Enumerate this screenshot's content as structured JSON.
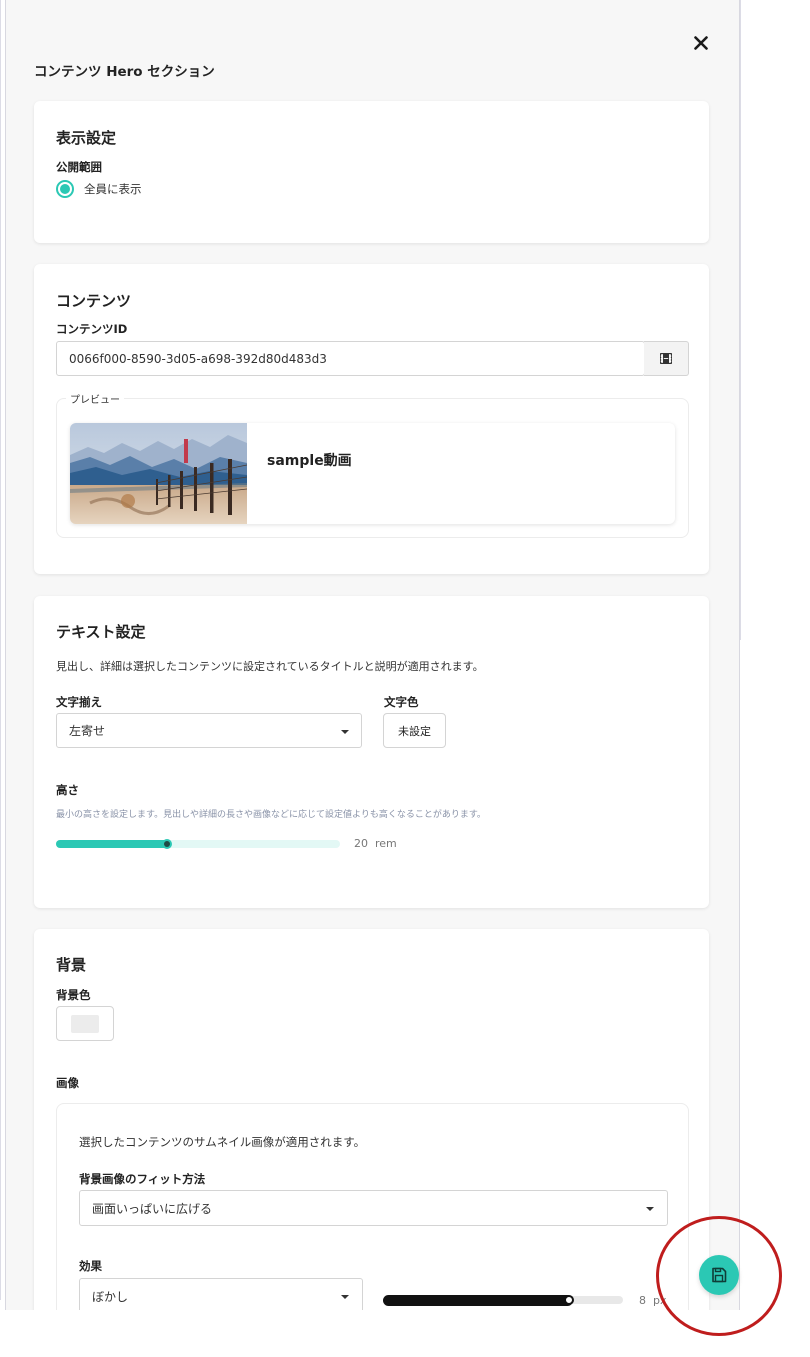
{
  "panel": {
    "title": "コンテンツ Hero セクション"
  },
  "display_settings": {
    "title": "表示設定",
    "visibility_label": "公開範囲",
    "visibility_option": "全員に表示"
  },
  "content": {
    "title": "コンテンツ",
    "id_label": "コンテンツID",
    "id_value": "0066f000-8590-3d05-a698-392d80d483d3",
    "preview_legend": "プレビュー",
    "preview_title": "sample動画"
  },
  "text_settings": {
    "title": "テキスト設定",
    "description": "見出し、詳細は選択したコンテンツに設定されているタイトルと説明が適用されます。",
    "align_label": "文字揃え",
    "align_value": "左寄せ",
    "color_label": "文字色",
    "color_value": "未設定",
    "height_label": "高さ",
    "height_help": "最小の高さを設定します。見出しや詳細の長さや画像などに応じて設定値よりも高くなることがあります。",
    "height_value": "20",
    "height_unit": "rem",
    "height_fraction": 0.4
  },
  "background": {
    "title": "背景",
    "color_label": "背景色",
    "image_label": "画像",
    "image_note": "選択したコンテンツのサムネイル画像が適用されます。",
    "fit_label": "背景画像のフィット方法",
    "fit_value": "画面いっぱいに広げる",
    "effect_label": "効果",
    "effect_value": "ぼかし",
    "effect_amount": "8",
    "effect_unit": "px",
    "effect_fraction": 0.79
  },
  "colors": {
    "accent": "#2bc8b4",
    "annotation": "#bf1d1d"
  }
}
